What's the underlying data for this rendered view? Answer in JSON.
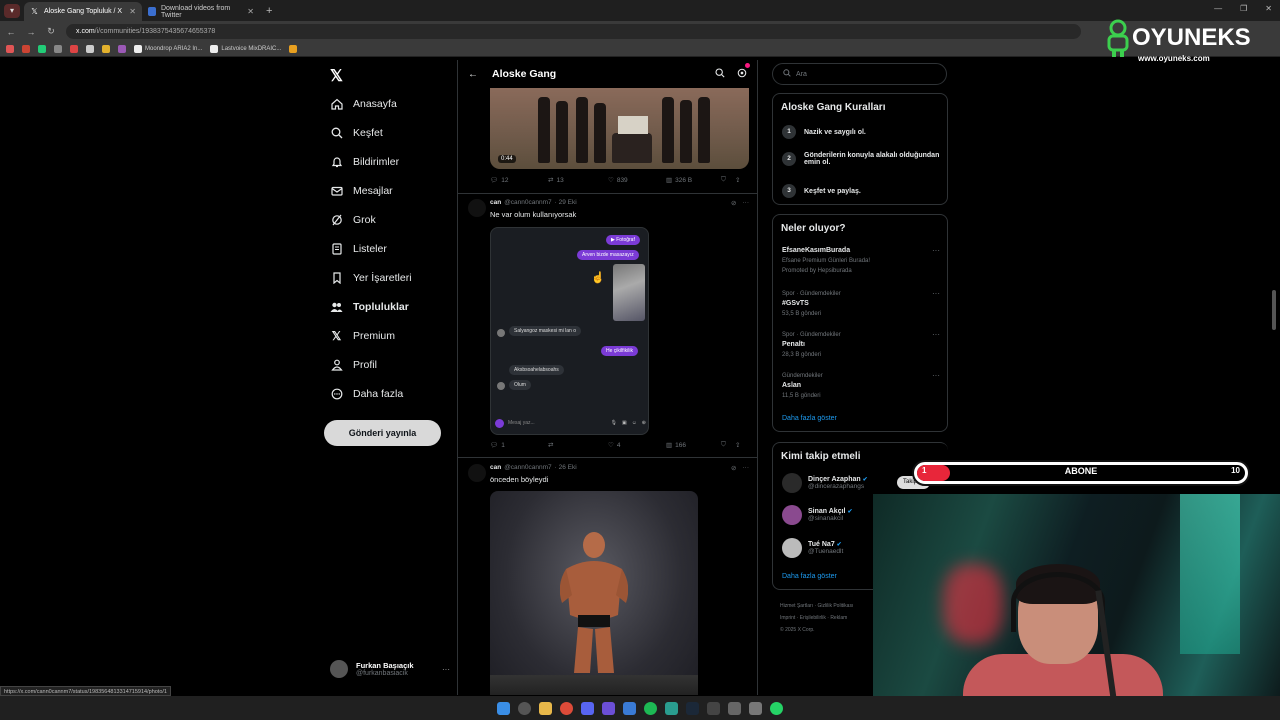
{
  "browser": {
    "tabs": [
      {
        "title": "Aloske Gang Topluluk / X",
        "icon": "x-icon",
        "active": true
      },
      {
        "title": "Download videos from Twitter",
        "icon": "download-icon",
        "active": false
      }
    ],
    "url_host": "x.com",
    "url_path": "/i/communities/1938375435674655378",
    "bookmarks": [
      "Moondrop ARIA2 In...",
      "Lastvoice MixDRAIC..."
    ]
  },
  "brand": {
    "name": "OYUNEKS",
    "url": "www.oyuneks.com"
  },
  "nav": {
    "items": [
      {
        "label": "Anasayfa",
        "icon": "home-icon"
      },
      {
        "label": "Keşfet",
        "icon": "search-icon"
      },
      {
        "label": "Bildirimler",
        "icon": "bell-icon"
      },
      {
        "label": "Mesajlar",
        "icon": "mail-icon"
      },
      {
        "label": "Grok",
        "icon": "grok-icon"
      },
      {
        "label": "Listeler",
        "icon": "list-icon"
      },
      {
        "label": "Yer İşaretleri",
        "icon": "bookmark-icon"
      },
      {
        "label": "Topluluklar",
        "icon": "communities-icon"
      },
      {
        "label": "Premium",
        "icon": "x-icon"
      },
      {
        "label": "Profil",
        "icon": "person-icon"
      },
      {
        "label": "Daha fazla",
        "icon": "more-circle-icon"
      }
    ],
    "post_button": "Gönderi yayınla",
    "profile_name": "Furkan Başıaçık",
    "profile_handle": "@furkanbasiacik"
  },
  "feed": {
    "title": "Aloske Gang",
    "video_duration": "0:44",
    "first_actions": {
      "replies": "12",
      "reposts": "13",
      "likes": "839",
      "views": "326 B"
    },
    "tweets": [
      {
        "name": "can",
        "handle": "@cann0cannm7",
        "date": "· 29 Eki",
        "text": "Ne var olum kullanıyorsak",
        "chat": {
          "photo_label": "▶ Fotoğraf",
          "out1": "Arven bizde masazayız",
          "in1": "Salyangoz maskesi mi lan o",
          "out2": "He çikilfikilik",
          "in2": "Aksbsoahelabsoahs",
          "in3": "Olum",
          "input_placeholder": "Mesaj yaz..."
        },
        "replies": "1",
        "reposts": "",
        "likes": "4",
        "views": "166"
      },
      {
        "name": "can",
        "handle": "@cann0cannm7",
        "date": "· 26 Eki",
        "text": "önceden böyleydi"
      }
    ]
  },
  "sidebar": {
    "search_placeholder": "Ara",
    "rules_title": "Aloske Gang Kuralları",
    "rules": [
      {
        "n": "1",
        "text": "Nazik ve saygılı ol."
      },
      {
        "n": "2",
        "text": "Gönderilerin konuyla alakalı olduğundan emin ol."
      },
      {
        "n": "3",
        "text": "Keşfet ve paylaş."
      }
    ],
    "trends_title": "Neler oluyor?",
    "trends": [
      {
        "meta": "",
        "title": "EfsaneKasımBurada",
        "sub": "Efsane Premium Günleri Burada!",
        "extra": "Promoted by Hepsiburada"
      },
      {
        "meta": "Spor · Gündemdekiler",
        "title": "#GSvTS",
        "sub": "53,5 B gönderi",
        "extra": ""
      },
      {
        "meta": "Spor · Gündemdekiler",
        "title": "Penaltı",
        "sub": "28,3 B gönderi",
        "extra": ""
      },
      {
        "meta": "Gündemdekiler",
        "title": "Aslan",
        "sub": "11,5 B gönderi",
        "extra": ""
      }
    ],
    "show_more": "Daha fazla göster",
    "who_title": "Kimi takip etmeli",
    "who": [
      {
        "name": "Dinçer Azaphan",
        "handle": "@dincerazaphangs"
      },
      {
        "name": "Sinan Akçıl",
        "handle": "@sinanakcil"
      },
      {
        "name": "Tué Na7",
        "handle": "@Tuenaedlt"
      }
    ],
    "who_more": "Daha fazla göster",
    "footer": [
      "Hizmet Şartları",
      "Gizlilik Politikası",
      "Imprint",
      "Erişilebilirlik",
      "Reklam",
      "© 2025 X Corp."
    ]
  },
  "overlay": {
    "subscribe_label": "ABONE",
    "start": "1",
    "goal": "10",
    "progress": 0.1,
    "takip": "Takip et"
  },
  "status_link": "https://x.com/cann0cannm7/status/1983564813314715914/photo/1",
  "colors": {
    "accent": "#1d9bf0",
    "chat_out": "#7b3bd6",
    "sub_bar": "#e8263a"
  }
}
